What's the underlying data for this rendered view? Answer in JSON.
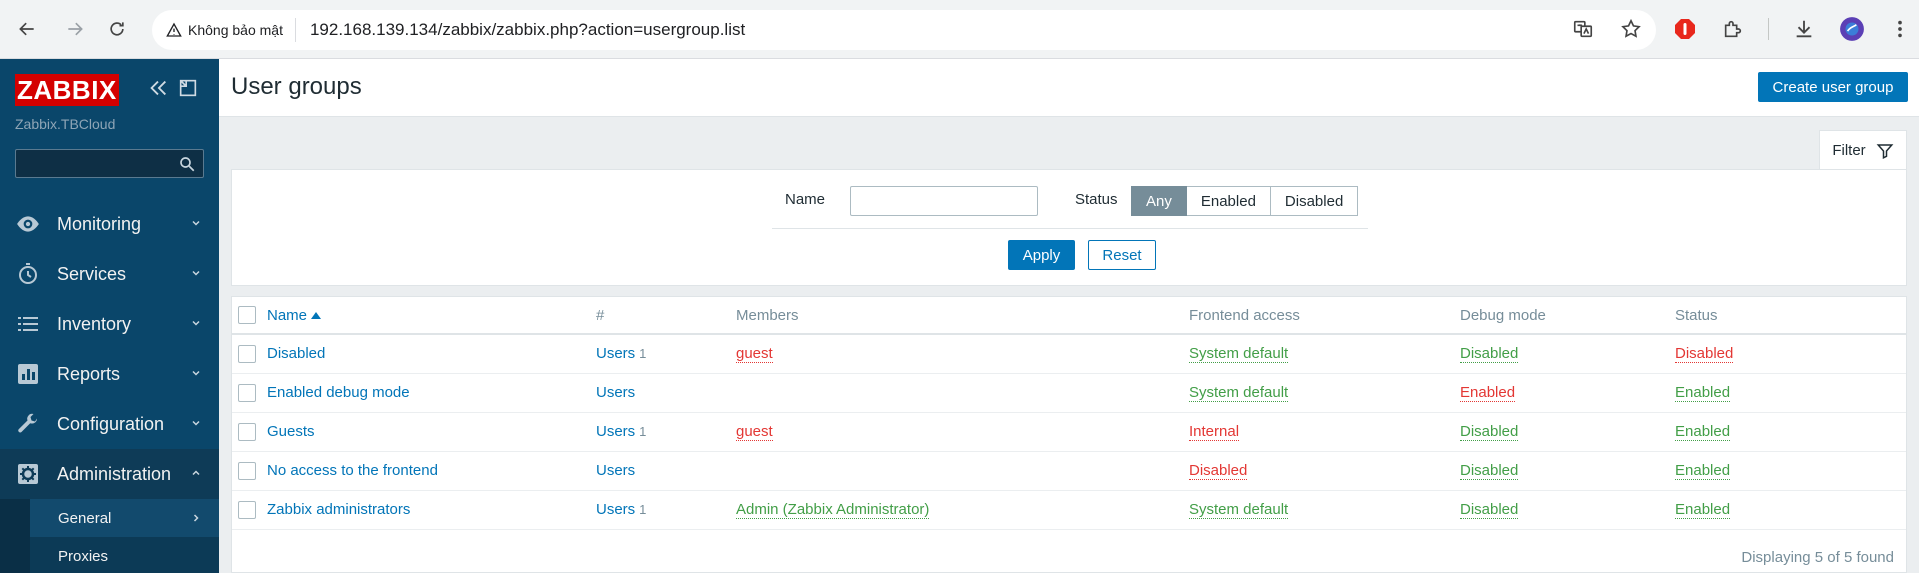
{
  "browser": {
    "insecure_label": "Không bảo mật",
    "url": "192.168.139.134/zabbix/zabbix.php?action=usergroup.list"
  },
  "sidebar": {
    "logo": "ZABBIX",
    "server_name": "Zabbix.TBCloud",
    "search_value": "",
    "menu": [
      {
        "label": "Monitoring",
        "icon": "eye-icon"
      },
      {
        "label": "Services",
        "icon": "stopwatch-icon"
      },
      {
        "label": "Inventory",
        "icon": "list-icon"
      },
      {
        "label": "Reports",
        "icon": "bar-chart-icon"
      },
      {
        "label": "Configuration",
        "icon": "wrench-icon"
      },
      {
        "label": "Administration",
        "icon": "gear-icon"
      }
    ],
    "submenu": [
      {
        "label": "General"
      },
      {
        "label": "Proxies"
      }
    ]
  },
  "header": {
    "title": "User groups",
    "create_label": "Create user group"
  },
  "filter": {
    "tab_label": "Filter",
    "name_label": "Name",
    "name_value": "",
    "status_label": "Status",
    "status_options": [
      "Any",
      "Enabled",
      "Disabled"
    ],
    "status_selected": "Any",
    "apply_label": "Apply",
    "reset_label": "Reset"
  },
  "table": {
    "columns": [
      "Name",
      "#",
      "Members",
      "Frontend access",
      "Debug mode",
      "Status"
    ],
    "rows": [
      {
        "name": "Disabled",
        "users": "Users",
        "count": "1",
        "members": "guest",
        "members_color": "red",
        "frontend": "System default",
        "frontend_color": "green",
        "debug": "Disabled",
        "debug_color": "green",
        "status": "Disabled",
        "status_color": "red"
      },
      {
        "name": "Enabled debug mode",
        "users": "Users",
        "count": "",
        "members": "",
        "members_color": "",
        "frontend": "System default",
        "frontend_color": "green",
        "debug": "Enabled",
        "debug_color": "red",
        "status": "Enabled",
        "status_color": "green"
      },
      {
        "name": "Guests",
        "users": "Users",
        "count": "1",
        "members": "guest",
        "members_color": "red",
        "frontend": "Internal",
        "frontend_color": "red",
        "debug": "Disabled",
        "debug_color": "green",
        "status": "Enabled",
        "status_color": "green"
      },
      {
        "name": "No access to the frontend",
        "users": "Users",
        "count": "",
        "members": "",
        "members_color": "",
        "frontend": "Disabled",
        "frontend_color": "red",
        "debug": "Disabled",
        "debug_color": "green",
        "status": "Enabled",
        "status_color": "green"
      },
      {
        "name": "Zabbix administrators",
        "users": "Users",
        "count": "1",
        "members": "Admin (Zabbix Administrator)",
        "members_color": "green",
        "frontend": "System default",
        "frontend_color": "green",
        "debug": "Disabled",
        "debug_color": "green",
        "status": "Enabled",
        "status_color": "green"
      }
    ],
    "footer": "Displaying 5 of 5 found"
  }
}
